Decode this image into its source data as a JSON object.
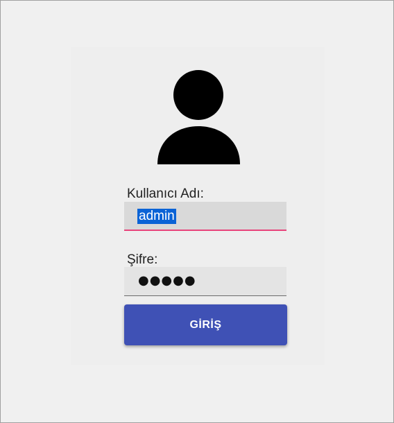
{
  "form": {
    "username_label": "Kullanıcı Adı:",
    "username_value": "admin",
    "password_label": "Şifre:",
    "password_mask": "●●●●●",
    "submit_label": "GİRİŞ"
  },
  "icons": {
    "avatar": "user-icon"
  },
  "colors": {
    "button": "#3f51b5",
    "focus_underline": "#e8437a",
    "selection": "#0a63d6"
  }
}
